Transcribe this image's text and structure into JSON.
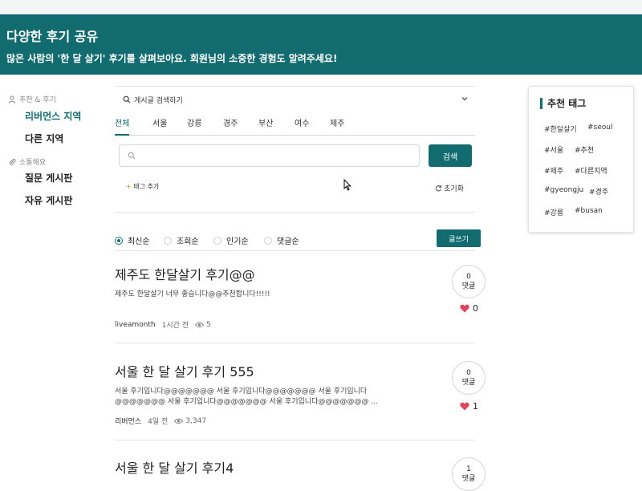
{
  "banner": {
    "title": "다양한 후기 공유",
    "subtitle": "많은 사람의 '한 달 살기' 후기를 살펴보아요. 회원님의 소중한 경험도 알려주세요!"
  },
  "sidebar": {
    "section1": "추천 & 후기",
    "items1": [
      "리버먼스 지역",
      "다른 지역"
    ],
    "section2": "소통해요",
    "items2": [
      "질문 게시판",
      "자유 게시판"
    ]
  },
  "search": {
    "toggle_label": "게시글 검색하기",
    "tabs": [
      "전체",
      "서울",
      "강릉",
      "경주",
      "부산",
      "여수",
      "제주"
    ],
    "input_placeholder": "",
    "button_label": "검색",
    "tag_add_label": "태그 추가",
    "reset_label": "초기화"
  },
  "sort": {
    "options": [
      "최신순",
      "조회순",
      "인기순",
      "댓글순"
    ],
    "selected": "최신순",
    "write_label": "글쓰기"
  },
  "posts": [
    {
      "title": "제주도 한달살기 후기@@",
      "body": "제주도 한달살기 너무 좋습니다@@추천합니다!!!!!",
      "author": "liveamonth",
      "time": "1시간 전",
      "views": "5",
      "comments": "0",
      "comment_label": "댓글",
      "likes": "0"
    },
    {
      "title": "서울 한 달 살기 후기 555",
      "body": "서울 후기입니다@@@@@@@ 서울 후기입니다@@@@@@@ 서울 후기입니다 @@@@@@@ 서울 후기입니다@@@@@@@ 서울 후기입니다@@@@@@@ ...",
      "author": "리버먼스",
      "time": "4일 전",
      "views": "3,347",
      "comments": "0",
      "comment_label": "댓글",
      "likes": "1"
    },
    {
      "title": "서울 한 달 살기 후기4",
      "comments": "1",
      "comment_label": "댓글"
    }
  ],
  "tags": {
    "title": "추천 태그",
    "items": [
      "#한달살기",
      "#seoul",
      "#서울",
      "#추천",
      "#제주",
      "#다른지역",
      "#gyeongju",
      "#경주",
      "#강릉",
      "#busan"
    ]
  },
  "colors": {
    "accent": "#126c6f",
    "heart": "#e0445b"
  }
}
